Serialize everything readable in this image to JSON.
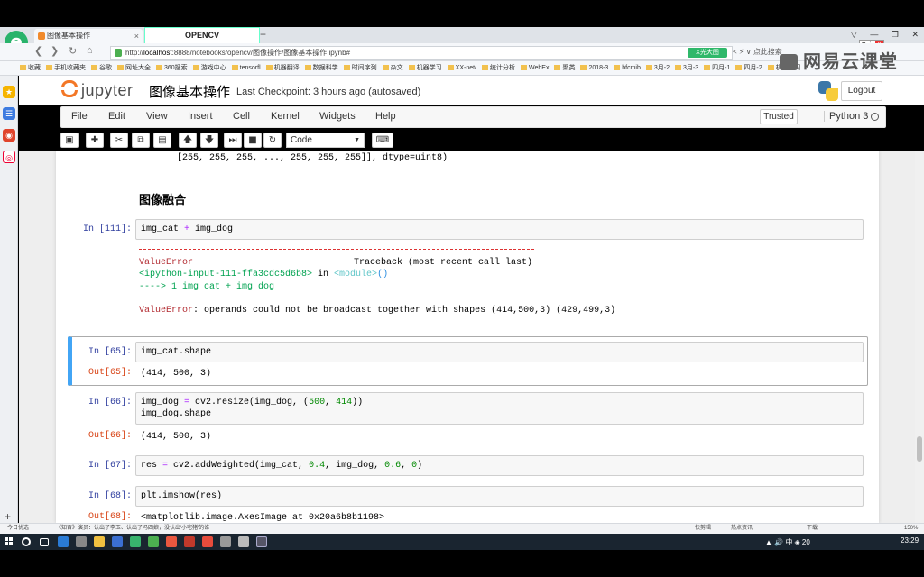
{
  "browser": {
    "tabs": [
      {
        "label": "图像基本操作"
      },
      {
        "label": "OPENCV"
      }
    ],
    "tab_close": "×",
    "tab_add": "+",
    "url_prefix": "http://",
    "url_host": "localhost",
    "url_path": ":8888/notebooks/opencv/图像操作/图像基本操作.ipynb#",
    "url_badge": "X光大图",
    "address_right": "< ⚡ ∨ 点此搜索",
    "bookmarks": [
      "收藏",
      "手机收藏夹",
      "谷歌",
      "网址大全",
      "360搜索",
      "游戏中心",
      "tensorfl",
      "机器翻译",
      "数据科学",
      "时间序列",
      "杂文",
      "机器学习",
      "XX-net/",
      "统计分析",
      "WebEx",
      "聚类",
      "2018-3",
      "bfcmib",
      "3月-2",
      "3月-3",
      "四月-1",
      "四月-2",
      "机器学习"
    ],
    "popup_label": "Poi...",
    "popup_close": "×",
    "window_controls": [
      "▽",
      "—",
      "❐",
      "✕"
    ],
    "sidebar_add": "+"
  },
  "watermark": "网易云课堂",
  "jupyter": {
    "brand": "jupyter",
    "notebook_title": "图像基本操作",
    "checkpoint": "Last Checkpoint: 3 hours ago (autosaved)",
    "logout": "Logout",
    "menu": [
      "File",
      "Edit",
      "View",
      "Insert",
      "Cell",
      "Kernel",
      "Widgets",
      "Help"
    ],
    "trusted": "Trusted",
    "kernel": "Python 3",
    "cell_type": "Code",
    "toolbar_icons": [
      "save-icon",
      "plus-icon",
      "cut-icon",
      "copy-icon",
      "paste-icon",
      "arrow-up-icon",
      "arrow-down-icon",
      "step-icon",
      "stop-icon",
      "restart-icon",
      "keyboard-icon"
    ]
  },
  "notebook": {
    "prev_output": "[255, 255, 255, ..., 255, 255, 255]], dtype=uint8)",
    "heading": "图像融合",
    "cells": [
      {
        "prompt": "In [111]:",
        "code_parts": [
          "img_cat ",
          "+",
          " img_dog"
        ],
        "error": {
          "name": "ValueError",
          "traceback_label": "Traceback (most recent call last)",
          "location": "<ipython-input-111-ffa3cdc5d6b8>",
          "in_word": " in ",
          "module": "<module>",
          "module_parens": "()",
          "arrow": "----> 1 img_cat + img_dog",
          "message_name": "ValueError",
          "message": ": operands could not be broadcast together with shapes (414,500,3) (429,499,3)"
        }
      },
      {
        "prompt_in": "In [65]:",
        "code": "img_cat.shape",
        "prompt_out": "Out[65]:",
        "output": "(414, 500, 3)"
      },
      {
        "prompt_in": "In [66]:",
        "code_line1_a": "img_dog ",
        "code_line1_eq": "=",
        "code_line1_b": " cv2.resize(img_dog, (",
        "code_line1_n1": "500",
        "code_line1_c": ", ",
        "code_line1_n2": "414",
        "code_line1_d": "))",
        "code_line2": "img_dog.shape",
        "prompt_out": "Out[66]:",
        "output": "(414, 500, 3)"
      },
      {
        "prompt_in": "In [67]:",
        "code_a": "res ",
        "code_eq": "=",
        "code_b": " cv2.addWeighted(img_cat, ",
        "code_n1": "0.4",
        "code_c": ", img_dog, ",
        "code_n2": "0.6",
        "code_d": ", ",
        "code_n3": "0",
        "code_e": ")"
      },
      {
        "prompt_in": "In [68]:",
        "code": "plt.imshow(res)",
        "prompt_out": "Out[68]:",
        "output": "<matplotlib.image.AxesImage at 0x20a6b8b1198>"
      }
    ]
  },
  "statusbar": {
    "left": "今日优选",
    "news": "《知否》演员：认出了李玉、认出了冯四娘，没认出'小宅猪'的谁",
    "right_items": [
      "快剪辑",
      "热点资讯",
      "下载",
      "",
      "",
      "150%"
    ]
  },
  "taskbar": {
    "time": "23:29",
    "tray": "▲ 🔊 中 ◈ 20"
  },
  "colors": {
    "jupyter_orange": "#f37726",
    "prompt_in": "#303f9f",
    "prompt_out": "#d84315",
    "selected_cell": "#42a5f5"
  }
}
